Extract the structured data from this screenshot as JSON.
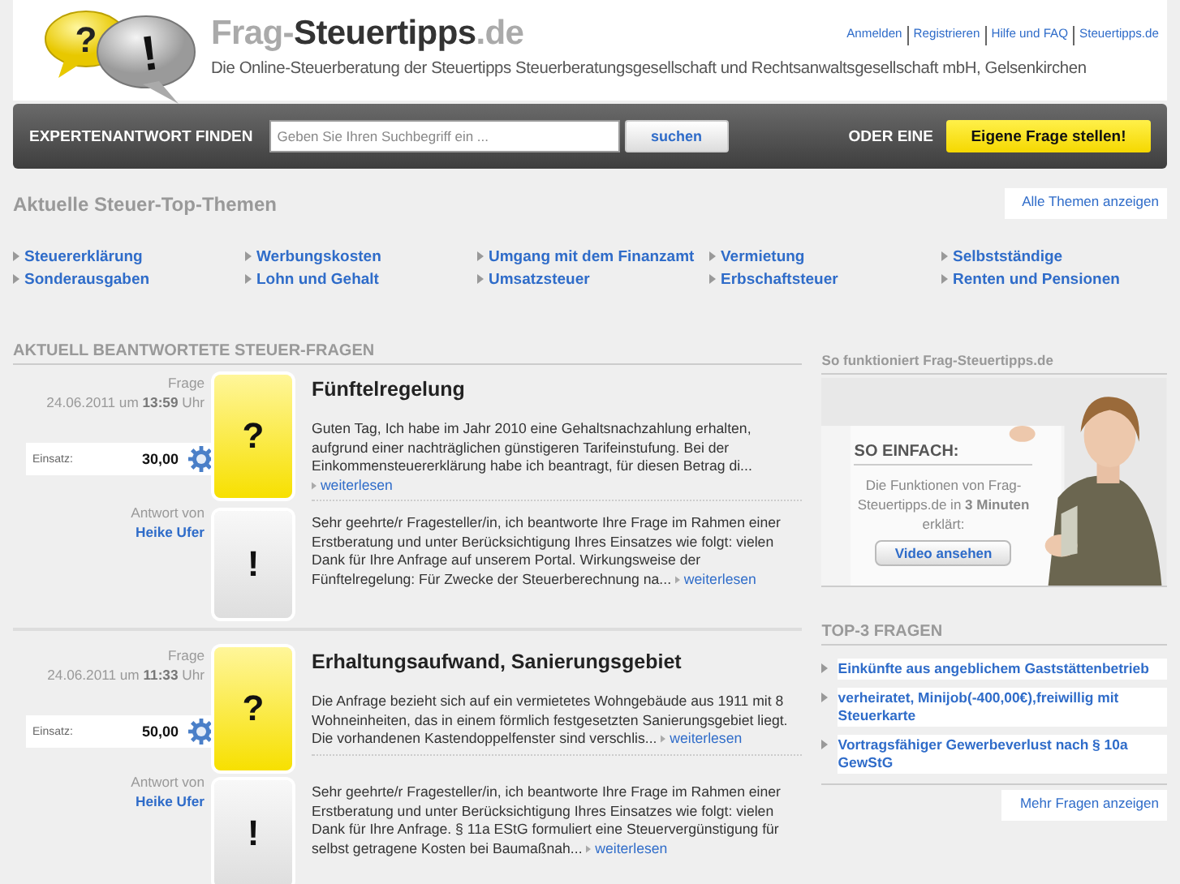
{
  "header": {
    "logo": {
      "bubble_1": "?",
      "bubble_2": "!",
      "part_1": "Frag-",
      "part_2": "Steuertipps",
      "part_3": ".de"
    },
    "tagline": "Die Online-Steuerberatung der Steuertipps Steuerberatungsgesellschaft und Rechtsanwaltsgesellschaft mbH, Gelsenkirchen",
    "links": [
      "Anmelden",
      "Registrieren",
      "Hilfe und FAQ",
      "Steuertipps.de"
    ]
  },
  "search_bar": {
    "label": "EXPERTENANTWORT FINDEN",
    "placeholder": "Geben Sie Ihren Suchbegriff ein ...",
    "button": "suchen",
    "or_label": "ODER EINE",
    "ask_button": "Eigene Frage stellen!"
  },
  "topics": {
    "title": "Aktuelle Steuer-Top-Themen",
    "all_link": "Alle Themen anzeigen",
    "items": [
      "Steuererklärung",
      "Werbungskosten",
      "Umgang mit dem Finanzamt",
      "Vermietung",
      "Selbstständige",
      "Sonderausgaben",
      "Lohn und Gehalt",
      "Umsatzsteuer",
      "Erbschaftsteuer",
      "Renten und Pensionen"
    ]
  },
  "questions": {
    "title": "AKTUELL BEANTWORTETE STEUER-FRAGEN",
    "items": [
      {
        "label": "Frage",
        "date": "24.06.2011 um **13:59**  Uhr",
        "stake_label": "Einsatz:",
        "stake": "30,00",
        "question_mark": "?",
        "title": "Fünftelregelung",
        "text": "Guten Tag, Ich habe im Jahr 2010 eine Gehaltsnachzahlung erhalten, aufgrund einer nachträglichen günstigeren Tarifeinstufung. Bei der Einkommensteuererklärung habe ich beantragt, für diesen Betrag di...",
        "more": "weiterlesen",
        "answer_label": "Antwort von",
        "author": "Heike Ufer",
        "answer_mark": "!",
        "answer_text": "Sehr geehrte/r Fragesteller/in, ich beantworte Ihre Frage im Rahmen einer Erstberatung und unter Berücksichtigung Ihres Einsatzes wie folgt: vielen Dank für Ihre Anfrage auf unserem Portal. Wirkungsweise der Fünftelregelung: Für Zwecke der Steuerberechnung na...",
        "answer_more": "weiterlesen"
      },
      {
        "label": "Frage",
        "date": "24.06.2011 um **11:33**  Uhr",
        "stake_label": "Einsatz:",
        "stake": "50,00",
        "question_mark": "?",
        "title": "Erhaltungsaufwand, Sanierungsgebiet",
        "text": "Die Anfrage bezieht sich auf ein vermietetes Wohngebäude aus 1911 mit 8 Wohneinheiten, das in einem förmlich festgesetzten Sanierungsgebiet liegt. Die vorhandenen Kastendoppelfenster sind verschlis...",
        "more": "weiterlesen",
        "answer_label": "Antwort von",
        "author": "Heike Ufer",
        "answer_mark": "!",
        "answer_text": "Sehr geehrte/r Fragesteller/in, ich beantworte Ihre Frage im Rahmen einer Erstberatung und unter Berücksichtigung Ihres Einsatzes wie folgt: vielen Dank für Ihre Anfrage. § 11a EStG formuliert eine Steuervergünstigung für selbst getragene Kosten bei Baumaßnah...",
        "answer_more": "weiterlesen"
      }
    ]
  },
  "sidebar": {
    "video_title": "So funktioniert Frag-Steuertipps.de",
    "promo": {
      "kind": "picture",
      "heading": "SO EINFACH:",
      "text": "Die Funktionen von Frag-Steuertipps.de in **3 Minuten** erklärt:",
      "button": "Video ansehen"
    },
    "top_title": "TOP-3 FRAGEN",
    "top_items": [
      "Einkünfte aus angeblichem Gaststättenbetrieb",
      "verheiratet, Minijob(-400,00€),freiwillig mit Steuerkarte",
      "Vortragsfähiger Gewerbeverlust nach § 10a GewStG"
    ],
    "more_link": "Mehr Fragen anzeigen"
  }
}
